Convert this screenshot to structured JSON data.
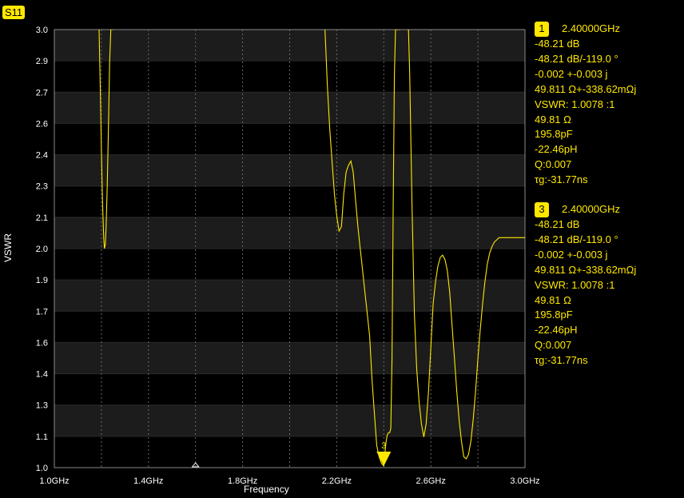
{
  "trace_badge": "S11",
  "chart_data": {
    "type": "line",
    "xlabel": "Frequency",
    "ylabel": "VSWR",
    "xlim": [
      1.0,
      3.0
    ],
    "ylim": [
      1.0,
      3.0
    ],
    "x_ticks": [
      1.0,
      1.2,
      1.4,
      1.6,
      1.8,
      2.0,
      2.2,
      2.4,
      2.6,
      2.8,
      3.0
    ],
    "x_tick_labels": [
      "1.0GHz",
      "",
      "1.4GHz",
      "",
      "1.8GHz",
      "",
      "2.2GHz",
      "",
      "2.6GHz",
      "",
      "3.0GHz"
    ],
    "y_tick_labels": [
      "1.0",
      "1.1",
      "1.3",
      "1.4",
      "1.6",
      "1.7",
      "1.9",
      "2.0",
      "2.1",
      "2.3",
      "2.4",
      "2.6",
      "2.7",
      "2.9",
      "3.0"
    ],
    "grid": true,
    "series": [
      {
        "color": "#ffe800",
        "x": [
          1.19,
          1.195,
          1.2,
          1.205,
          1.21,
          1.213,
          1.217,
          1.22,
          1.225,
          1.23,
          1.235,
          1.24,
          1.245,
          1.25,
          null,
          2.15,
          2.16,
          2.17,
          2.18,
          2.19,
          2.2,
          2.21,
          2.22,
          2.23,
          2.24,
          2.25,
          2.26,
          2.27,
          2.28,
          2.29,
          2.3,
          2.31,
          2.32,
          2.33,
          2.34,
          2.35,
          2.36,
          2.37,
          2.38,
          2.39,
          2.4,
          2.41,
          2.415,
          2.42,
          2.425,
          2.43,
          2.435,
          2.44,
          2.445,
          2.45,
          2.455,
          2.46,
          2.465,
          2.47,
          null,
          2.5,
          2.505,
          2.51,
          2.52,
          2.53,
          2.54,
          2.55,
          2.56,
          2.57,
          2.58,
          2.59,
          2.6,
          2.61,
          2.62,
          2.63,
          2.64,
          2.65,
          2.66,
          2.67,
          2.68,
          2.69,
          2.7,
          2.71,
          2.72,
          2.73,
          2.74,
          2.75,
          2.76,
          2.77,
          2.78,
          2.79,
          2.8,
          2.81,
          2.82,
          2.83,
          2.84,
          2.85,
          2.86,
          2.87,
          2.88,
          2.89,
          2.9,
          2.91,
          2.92,
          2.93,
          2.94,
          2.95,
          2.96,
          2.97,
          2.98,
          2.99,
          3.0
        ],
        "y": [
          3.0,
          2.75,
          2.45,
          2.2,
          2.05,
          2.0,
          2.02,
          2.1,
          2.3,
          2.55,
          2.85,
          3.0,
          3.0,
          3.0,
          null,
          3.0,
          2.75,
          2.55,
          2.4,
          2.25,
          2.15,
          2.08,
          2.1,
          2.25,
          2.35,
          2.38,
          2.4,
          2.35,
          2.22,
          2.1,
          2.0,
          1.9,
          1.8,
          1.7,
          1.6,
          1.4,
          1.25,
          1.1,
          1.05,
          1.02,
          1.008,
          1.12,
          1.15,
          1.16,
          1.16,
          1.18,
          1.5,
          2.2,
          2.8,
          3.0,
          3.0,
          3.0,
          3.0,
          3.0,
          null,
          3.0,
          3.0,
          2.8,
          2.2,
          1.7,
          1.45,
          1.3,
          1.2,
          1.14,
          1.2,
          1.35,
          1.55,
          1.75,
          1.85,
          1.92,
          1.96,
          1.97,
          1.95,
          1.9,
          1.8,
          1.65,
          1.5,
          1.35,
          1.22,
          1.12,
          1.05,
          1.04,
          1.06,
          1.12,
          1.22,
          1.35,
          1.5,
          1.63,
          1.75,
          1.85,
          1.93,
          1.98,
          2.01,
          2.03,
          2.04,
          2.05,
          2.05,
          2.05,
          2.05,
          2.05,
          2.05,
          2.05,
          2.05,
          2.05,
          2.05,
          2.05,
          2.05
        ]
      }
    ],
    "markers": [
      {
        "label": "3",
        "x": 2.4,
        "y": 1.0
      }
    ]
  },
  "markers_panel": [
    {
      "number": "1",
      "freq": "2.40000GHz",
      "lines": [
        "-48.21 dB",
        "-48.21 dB/-119.0 °",
        "-0.002 +-0.003 j",
        "49.811 Ω+-338.62mΩj",
        "VSWR: 1.0078 :1",
        "49.81 Ω",
        "195.8pF",
        "-22.46pH",
        "Q:0.007",
        "τg:-31.77ns"
      ]
    },
    {
      "number": "3",
      "freq": "2.40000GHz",
      "lines": [
        "-48.21 dB",
        "-48.21 dB/-119.0 °",
        "-0.002 +-0.003 j",
        "49.811 Ω+-338.62mΩj",
        "VSWR: 1.0078 :1",
        "49.81 Ω",
        "195.8pF",
        "-22.46pH",
        "Q:0.007",
        "τg:-31.77ns"
      ]
    }
  ]
}
